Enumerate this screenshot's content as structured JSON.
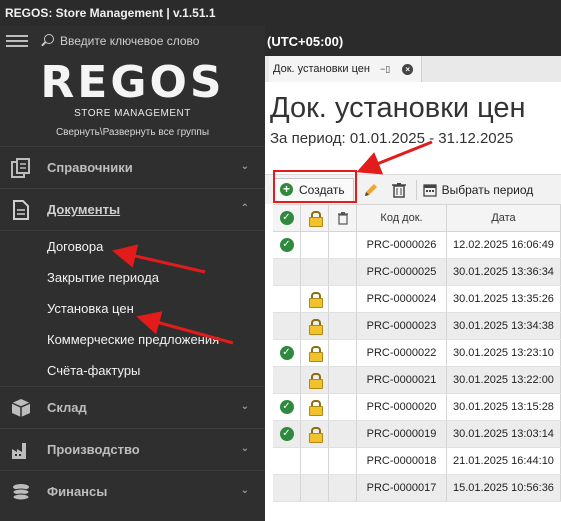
{
  "window": {
    "title": "REGOS: Store Management | v.1.51.1"
  },
  "sidebar": {
    "search_placeholder": "Введите ключевое слово",
    "logo": "REGOS",
    "logo_sub": "STORE MANAGEMENT",
    "toggle_groups": "Свернуть\\Развернуть все группы",
    "sections": {
      "directories": "Справочники",
      "documents": "Документы",
      "warehouse": "Склад",
      "production": "Производство",
      "finance": "Финансы"
    },
    "documents_items": [
      "Договора",
      "Закрытие периода",
      "Установка цен",
      "Коммерческие предложения",
      "Счёта-фактуры"
    ]
  },
  "header": {
    "timezone": "(UTC+05:00)"
  },
  "tab": {
    "label": "Док. установки цен"
  },
  "document": {
    "title": "Док. установки цен",
    "period": "За период: 01.01.2025 - 31.12.2025"
  },
  "toolbar": {
    "create_label": "Создать",
    "select_period_label": "Выбрать период"
  },
  "grid": {
    "columns": [
      "",
      "",
      "",
      "Код док.",
      "Дата"
    ],
    "rows": [
      {
        "checked": true,
        "locked": false,
        "code": "PRC-0000026",
        "date": "12.02.2025 16:06:49"
      },
      {
        "checked": false,
        "locked": false,
        "code": "PRC-0000025",
        "date": "30.01.2025 13:36:34"
      },
      {
        "checked": false,
        "locked": true,
        "code": "PRC-0000024",
        "date": "30.01.2025 13:35:26"
      },
      {
        "checked": false,
        "locked": true,
        "code": "PRC-0000023",
        "date": "30.01.2025 13:34:38"
      },
      {
        "checked": true,
        "locked": true,
        "code": "PRC-0000022",
        "date": "30.01.2025 13:23:10"
      },
      {
        "checked": false,
        "locked": true,
        "code": "PRC-0000021",
        "date": "30.01.2025 13:22:00"
      },
      {
        "checked": true,
        "locked": true,
        "code": "PRC-0000020",
        "date": "30.01.2025 13:15:28"
      },
      {
        "checked": true,
        "locked": true,
        "code": "PRC-0000019",
        "date": "30.01.2025 13:03:14"
      },
      {
        "checked": false,
        "locked": false,
        "code": "PRC-0000018",
        "date": "21.01.2025 16:44:10"
      },
      {
        "checked": false,
        "locked": false,
        "code": "PRC-0000017",
        "date": "15.01.2025 10:56:36"
      }
    ]
  },
  "colors": {
    "annotation": "#e21b1b",
    "success": "#2f8a3e",
    "sidebar_bg": "#2f2f2f"
  }
}
